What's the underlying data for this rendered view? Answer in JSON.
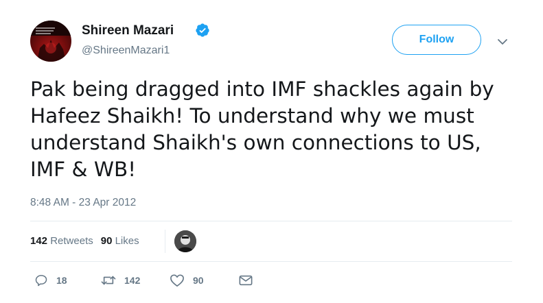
{
  "author": {
    "display_name": "Shireen Mazari",
    "handle": "@ShireenMazari1",
    "avatar_icon": "profile-photo",
    "verified_icon": "verified-badge-icon"
  },
  "header": {
    "follow_label": "Follow",
    "menu_icon": "chevron-down-icon"
  },
  "tweet": {
    "text_lines": [
      "Pak being dragged into IMF shackles again by",
      "Hafeez Shaikh! To understand why we must",
      "understand Shaikh's own connections to US,",
      "IMF & WB!"
    ],
    "timestamp": "8:48 AM - 23 Apr 2012"
  },
  "stats": {
    "retweets_count": "142",
    "retweets_label": "Retweets",
    "likes_count": "90",
    "likes_label": "Likes"
  },
  "actions": {
    "reply_count": "18",
    "retweet_count": "142",
    "like_count": "90",
    "reply_icon": "reply-icon",
    "retweet_icon": "retweet-icon",
    "like_icon": "heart-icon",
    "dm_icon": "envelope-icon"
  },
  "colors": {
    "accent": "#1da1f2",
    "text": "#14171a",
    "secondary": "#657786",
    "divider": "#e6ecf0"
  }
}
